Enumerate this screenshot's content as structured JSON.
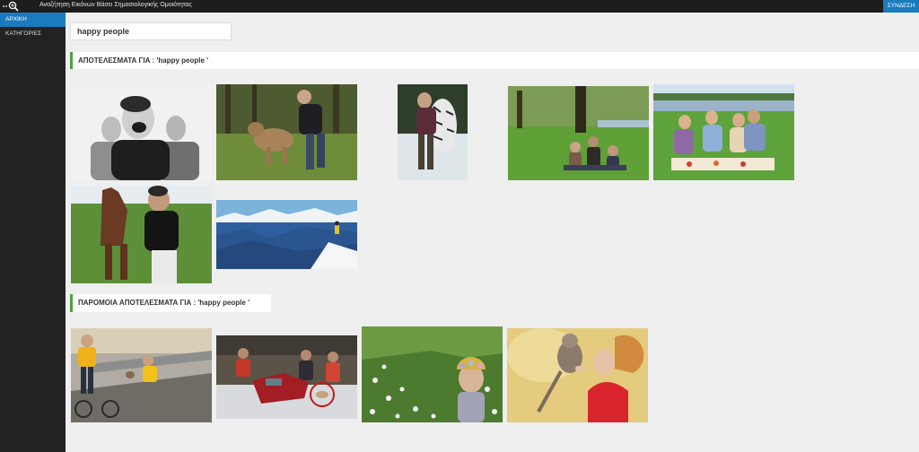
{
  "header": {
    "title": "Αναζήτηση Εικόνων Βάσει Σημασιολογικής Ομοιότητας",
    "login_label": "ΣΥΝΔΕΣΗ",
    "logo_icon": "search-zoom-icon"
  },
  "sidebar": {
    "items": [
      {
        "label": "ΑΡΧΙΚΗ",
        "active": true
      },
      {
        "label": "ΚΑΤΗΓΟΡΙΕΣ",
        "active": false
      }
    ]
  },
  "search": {
    "value": "happy people"
  },
  "results": {
    "heading": "ΑΠΟΤΕΛΕΣΜΑΤΑ ΓΙΑ : 'happy people '"
  },
  "similar": {
    "heading": "ΠΑΡΟΜΟΙΑ ΑΠΟΤΕΛΕΣΜΑΤΑ ΓΙΑ : 'happy people '"
  },
  "colors": {
    "accent": "#1a7bbf",
    "section_bar": "#4aa23a",
    "topbar": "#1d1d1d",
    "sidebar": "#222222"
  }
}
